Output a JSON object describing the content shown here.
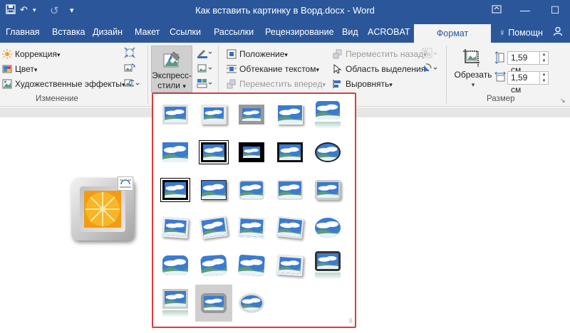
{
  "window": {
    "title": "Как вставить картинку в Ворд.docx - Word"
  },
  "tabs": [
    "Главная",
    "Вставка",
    "Дизайн",
    "Макет",
    "Ссылки",
    "Рассылки",
    "Рецензирование",
    "Вид",
    "ACROBAT"
  ],
  "active_tab": "Формат",
  "help": "Помощн",
  "ribbon": {
    "adjust": {
      "correction": "Коррекция",
      "color": "Цвет",
      "artistic": "Художественные эффекты",
      "label": "Изменение"
    },
    "styles": {
      "quick_styles_line1": "Экспресс-",
      "quick_styles_line2": "стили"
    },
    "arrange": {
      "position": "Положение",
      "wrap": "Обтекание текстом",
      "bring_forward": "Переместить вперед",
      "send_backward": "Переместить назад",
      "selection_pane": "Область выделения",
      "align": "Выровнять"
    },
    "size": {
      "crop": "Обрезать",
      "height": "1,59 см",
      "width": "1,59 см",
      "label": "Размер"
    }
  },
  "gallery": {
    "styles": [
      "simple-frame-white",
      "beveled-matte-white",
      "metal-frame",
      "drop-shadow-rectangle",
      "reflected-rounded-rectangle",
      "soft-edge-rectangle",
      "double-frame-black",
      "thick-matte-black",
      "simple-frame-black",
      "beveled-oval-black",
      "compound-frame-black",
      "center-shadow-rectangle",
      "rounded-diagonal-corner-white",
      "snip-diagonal-corner-white",
      "moderate-frame-white",
      "rotated-white",
      "perspective-shadow-white",
      "relaxed-perspective-white",
      "soft-edge-oval",
      "bevel-rectangle",
      "bevel-perspective",
      "reflected-perspective-right",
      "bevel-perspective-left-white",
      "reflected-bevel-white",
      "reflected-bevel-black",
      "reflected-rounded-rectangle-2",
      "metal-rounded-rectangle",
      "metal-oval"
    ],
    "selected_index": 26
  },
  "colors": {
    "accent": "#2b579a",
    "highlight_border": "#e03a3a",
    "sky": "#3b7bd1",
    "hill": "#5b9a7f"
  }
}
